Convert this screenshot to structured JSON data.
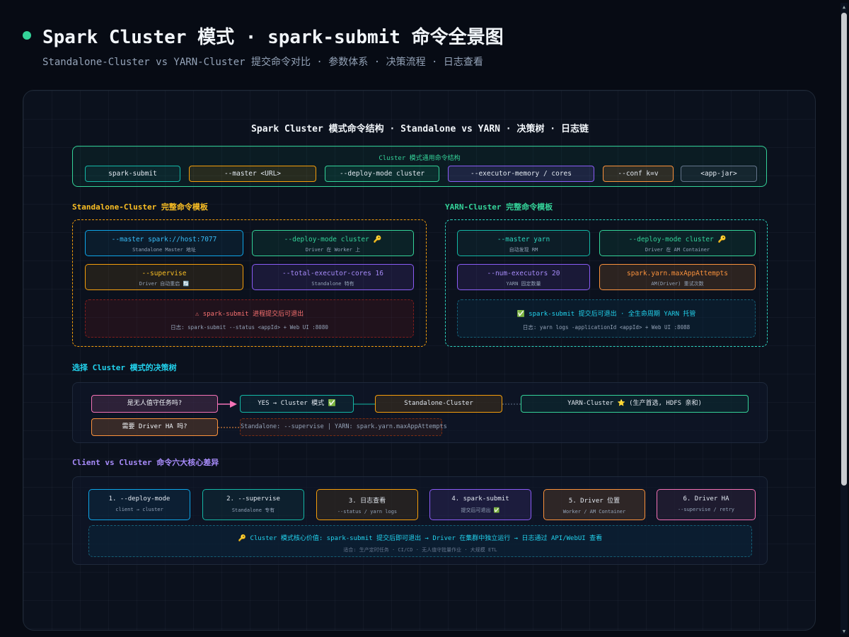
{
  "header": {
    "title": "Spark Cluster 模式 · spark-submit 命令全景图",
    "subtitle": "Standalone-Cluster vs YARN-Cluster 提交命令对比 · 参数体系 · 决策流程 · 日志查看"
  },
  "diagram": {
    "title": "Spark Cluster 模式命令结构 · Standalone vs YARN · 决策树 · 日志链",
    "common": {
      "title": "Cluster 模式通用命令结构",
      "pills": [
        "spark-submit",
        "--master <URL>",
        "--deploy-mode cluster",
        "--executor-memory / cores",
        "--conf k=v",
        "<app-jar>"
      ]
    },
    "standalone": {
      "label": "Standalone-Cluster 完整命令模板",
      "cells": [
        {
          "title": "--master spark://host:7077",
          "sub": "Standalone Master 地址"
        },
        {
          "title": "--deploy-mode cluster 🔑",
          "sub": "Driver 在 Worker 上"
        },
        {
          "title": "--supervise",
          "sub": "Driver 自动重启 🔄"
        },
        {
          "title": "--total-executor-cores 16",
          "sub": "Standalone 特有"
        }
      ],
      "info_title": "⚠ spark-submit 进程提交后可退出",
      "info_sub": "日志: spark-submit --status <appId> + Web UI :8080"
    },
    "yarn": {
      "label": "YARN-Cluster 完整命令模板",
      "cells": [
        {
          "title": "--master yarn",
          "sub": "自动发现 RM"
        },
        {
          "title": "--deploy-mode cluster 🔑",
          "sub": "Driver 在 AM Container"
        },
        {
          "title": "--num-executors 20",
          "sub": "YARN 固定数量"
        },
        {
          "title": "spark.yarn.maxAppAttempts",
          "sub": "AM(Driver) 重试次数"
        }
      ],
      "info_title": "✅ spark-submit 提交后可退出 · 全生命周期 YARN 托管",
      "info_sub": "日志: yarn logs -applicationId <appId> + Web UI :8088"
    },
    "decision": {
      "label": "选择 Cluster 模式的决策树",
      "q1": "是无人值守任务吗?",
      "yes": "YES → Cluster 模式 ✅",
      "standalone": "Standalone-Cluster",
      "yarn": "YARN-Cluster ⭐ (生产首选, HDFS 亲和)",
      "q2": "需要 Driver HA 吗?",
      "ha_answer": "Standalone: --supervise | YARN: spark.yarn.maxAppAttempts"
    },
    "diffs": {
      "label": "Client vs Cluster 命令六大核心差异",
      "items": [
        {
          "title": "1. --deploy-mode",
          "sub": "client → cluster"
        },
        {
          "title": "2. --supervise",
          "sub": "Standalone 专有"
        },
        {
          "title": "3. 日志查看",
          "sub": "--status / yarn logs"
        },
        {
          "title": "4. spark-submit",
          "sub": "提交后可退出 ✅"
        },
        {
          "title": "5. Driver 位置",
          "sub": "Worker / AM Container"
        },
        {
          "title": "6. Driver HA",
          "sub": "--supervise / retry"
        }
      ],
      "value_title": "🔑 Cluster 模式核心价值: spark-submit 提交后即可退出 → Driver 在集群中独立运行 → 日志通过 API/WebUI 查看",
      "value_sub": "适合: 生产定时任务 · CI/CD · 无人值守批量作业 · 大规模 ETL"
    }
  },
  "colors": {
    "green": "#34d399",
    "amber": "#fbbf24",
    "cyan": "#22d3ee",
    "violet": "#a78bfa",
    "orange": "#fb923c",
    "pink": "#f472b6",
    "red": "#f87171"
  }
}
